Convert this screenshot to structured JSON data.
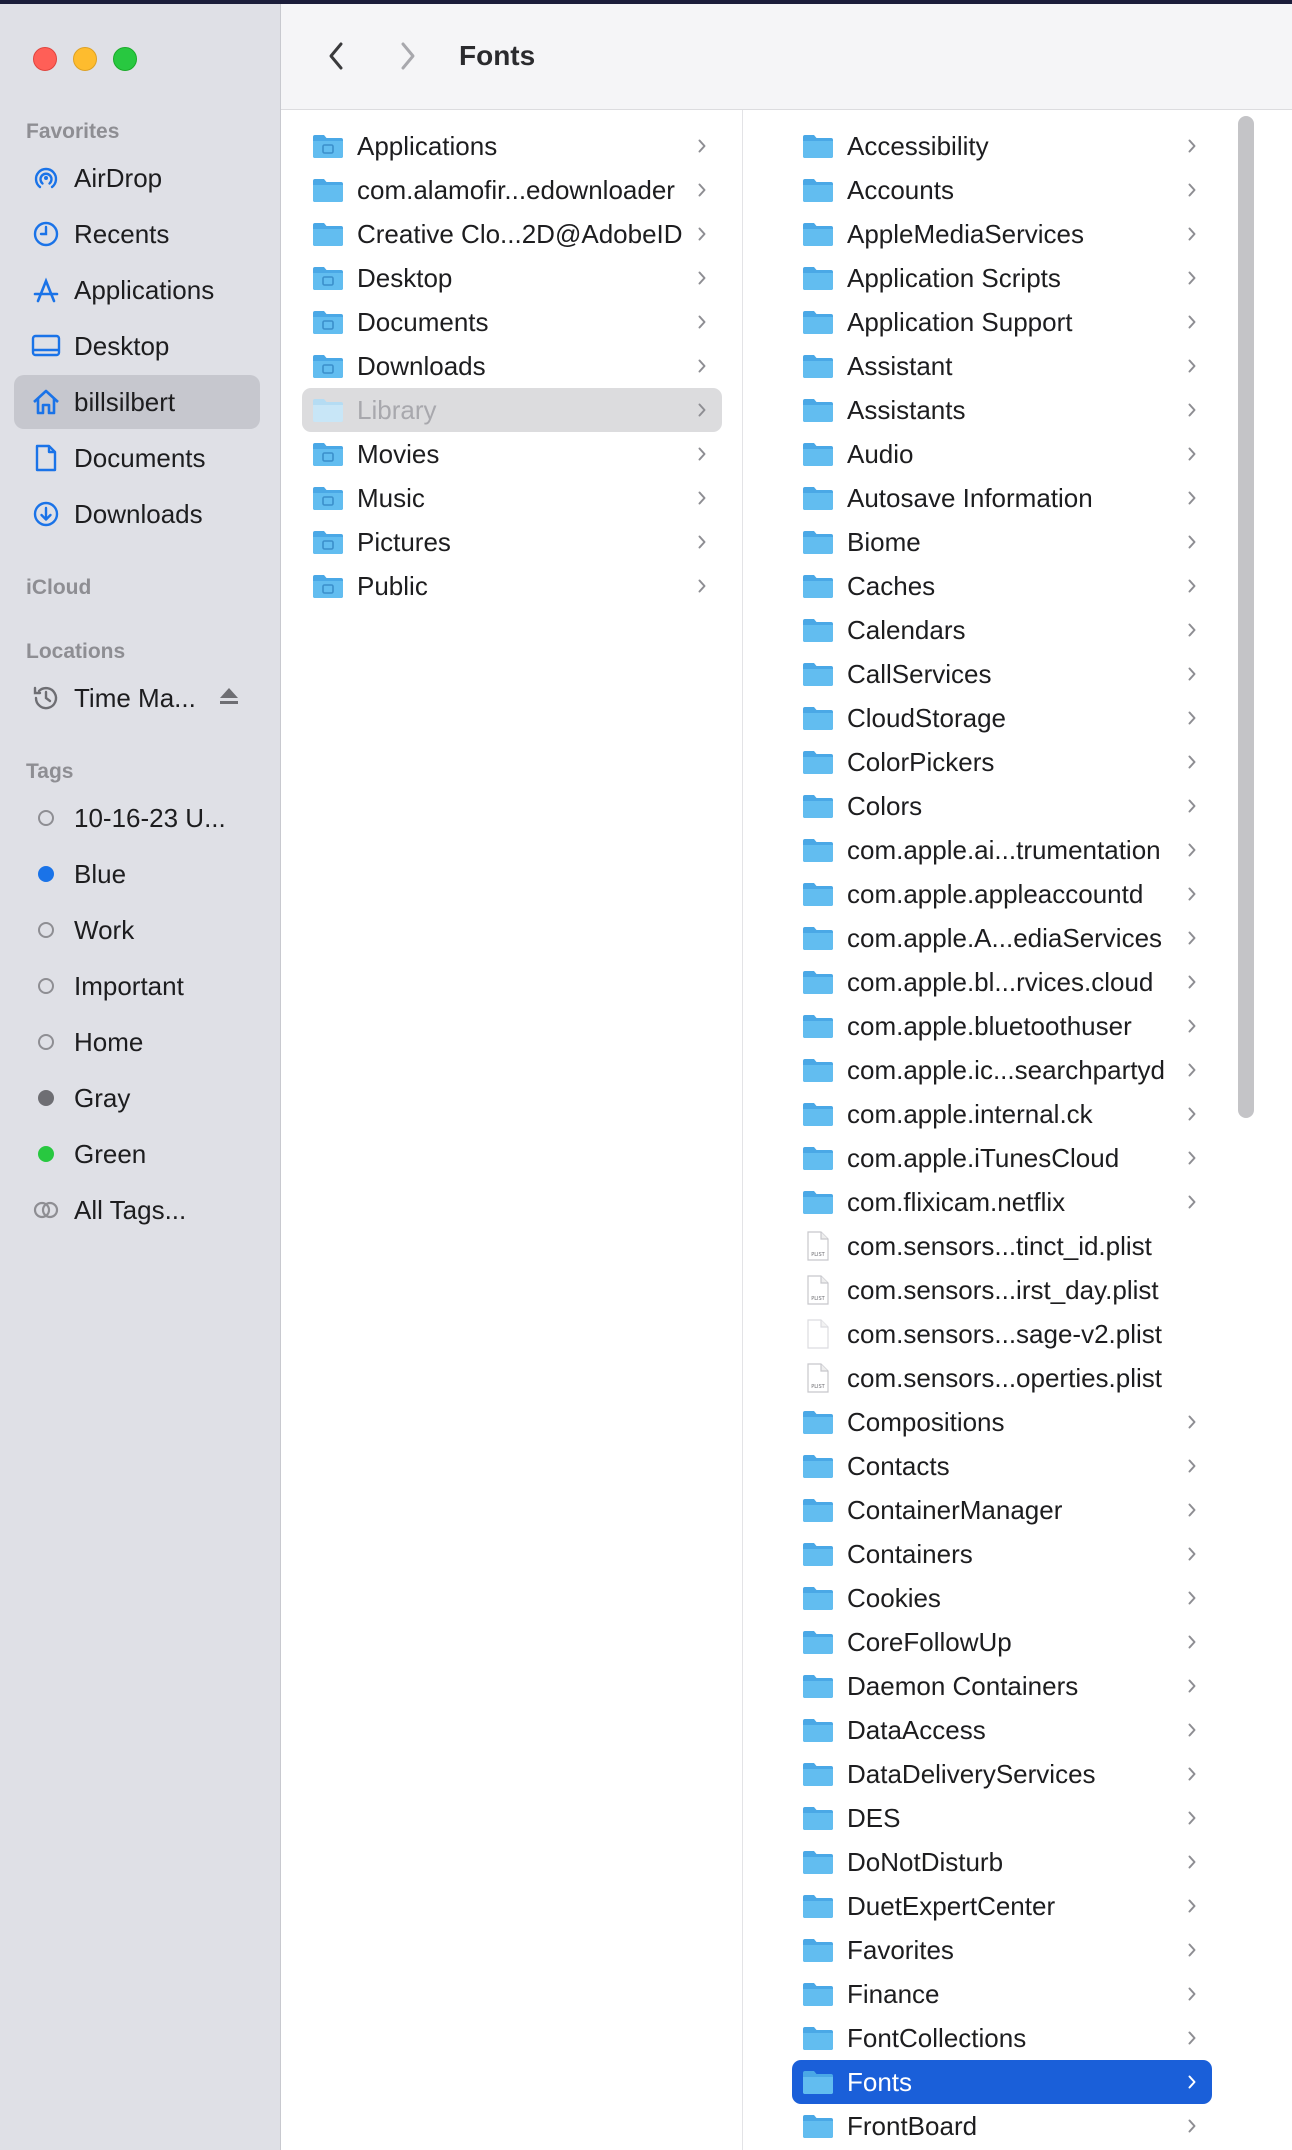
{
  "window": {
    "title": "Fonts"
  },
  "sidebar": {
    "favorites_header": "Favorites",
    "favorites": [
      {
        "label": "AirDrop",
        "icon": "airdrop-icon"
      },
      {
        "label": "Recents",
        "icon": "clock-icon"
      },
      {
        "label": "Applications",
        "icon": "applications-icon"
      },
      {
        "label": "Desktop",
        "icon": "desktop-icon"
      },
      {
        "label": "billsilbert",
        "icon": "home-icon"
      },
      {
        "label": "Documents",
        "icon": "document-icon"
      },
      {
        "label": "Downloads",
        "icon": "downloads-icon"
      }
    ],
    "icloud_header": "iCloud",
    "locations_header": "Locations",
    "locations": [
      {
        "label": "Time Ma...",
        "icon": "time-machine-icon"
      }
    ],
    "tags_header": "Tags",
    "tags": [
      {
        "label": "10-16-23 U...",
        "color": ""
      },
      {
        "label": "Blue",
        "color": "#1a73e8"
      },
      {
        "label": "Work",
        "color": ""
      },
      {
        "label": "Important",
        "color": ""
      },
      {
        "label": "Home",
        "color": ""
      },
      {
        "label": "Gray",
        "color": "#6e6e73"
      },
      {
        "label": "Green",
        "color": "#28c840"
      },
      {
        "label": "All Tags...",
        "color": ""
      }
    ]
  },
  "column1": {
    "items": [
      "Applications",
      "com.alamofir...edownloader",
      "Creative Clo...2D@AdobeID",
      "Desktop",
      "Documents",
      "Downloads",
      "Library",
      "Movies",
      "Music",
      "Pictures",
      "Public"
    ]
  },
  "column2": {
    "items": [
      "Accessibility",
      "Accounts",
      "AppleMediaServices",
      "Application Scripts",
      "Application Support",
      "Assistant",
      "Assistants",
      "Audio",
      "Autosave Information",
      "Biome",
      "Caches",
      "Calendars",
      "CallServices",
      "CloudStorage",
      "ColorPickers",
      "Colors",
      "com.apple.ai...trumentation",
      "com.apple.appleaccountd",
      "com.apple.A...ediaServices",
      "com.apple.bl...rvices.cloud",
      "com.apple.bluetoothuser",
      "com.apple.ic...searchpartyd",
      "com.apple.internal.ck",
      "com.apple.iTunesCloud",
      "com.flixicam.netflix",
      "com.sensors...tinct_id.plist",
      "com.sensors...irst_day.plist",
      "com.sensors...sage-v2.plist",
      "com.sensors...operties.plist",
      "Compositions",
      "Contacts",
      "ContainerManager",
      "Containers",
      "Cookies",
      "CoreFollowUp",
      "Daemon Containers",
      "DataAccess",
      "DataDeliveryServices",
      "DES",
      "DoNotDisturb",
      "DuetExpertCenter",
      "Favorites",
      "Finance",
      "FontCollections",
      "Fonts",
      "FrontBoard"
    ],
    "file_icon_text": "PLIST"
  },
  "colors": {
    "accent": "#1a5fd9",
    "folder": "#5ab4ec",
    "sidebar_icon": "#1a73e8"
  }
}
